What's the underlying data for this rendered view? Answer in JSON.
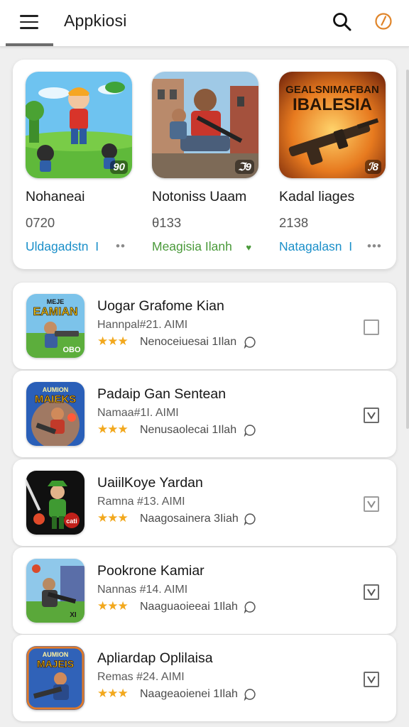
{
  "header": {
    "title": "Appkiosi"
  },
  "icons": {
    "menu": "hamburger-menu-icon",
    "search": "search-icon",
    "history": "clock-history-icon"
  },
  "colors": {
    "accent_blue": "#1a8fc9",
    "accent_green": "#4a9a3a",
    "star": "#f2a81d",
    "history_icon": "#e0852a"
  },
  "featured": [
    {
      "name": "Nohaneai",
      "count": "0720",
      "action": "Uldagadstn",
      "action_suffix": "I",
      "more": "••",
      "badge": "90",
      "action_color": "#1a8fc9"
    },
    {
      "name": "Notoniss Uaam",
      "count": "θ133",
      "action": "Meagisia Ilanh",
      "action_suffix": "♥",
      "more": "",
      "badge": "ℑ9",
      "action_color": "#4a9a3a"
    },
    {
      "name": "Kadal liages",
      "count": "2138",
      "action": "Natagalasn",
      "action_suffix": "I",
      "more": "•••",
      "badge": "ℐ8",
      "action_color": "#1a8fc9",
      "thumb_text_top": "GEALSNIMAFBAN",
      "thumb_text_bottom": "IBALESIA"
    }
  ],
  "list": [
    {
      "title": "Uogar Grafome Kian",
      "sub": "Hannpal#21. AIMI",
      "stars": "★★★",
      "meta": "Nenoceiuesai 1Ilan",
      "checked": false,
      "thumb_text": "EAMIAN",
      "thumb_top": "MEJE"
    },
    {
      "title": "Padaip Gan Sentean",
      "sub": "Namaa#1I. AIMI",
      "stars": "★★★",
      "meta": "Nenusaolecai 1Ilah",
      "checked": true,
      "thumb_text": "MAIEKS",
      "thumb_top": "AUMION"
    },
    {
      "title": "UaiilKoye Yardan",
      "sub": "Ramna #13. AIMI",
      "stars": "★★★",
      "meta": "Naagosainera 3Iiah",
      "checked": true,
      "thumb_text": "cati",
      "thumb_top": ""
    },
    {
      "title": "Pookrone Kamiar",
      "sub": "Nannas #14. AIMI",
      "stars": "★★★",
      "meta": "Naaguaoieeai 1Ilah",
      "checked": true,
      "thumb_text": "XI",
      "thumb_top": ""
    },
    {
      "title": "Apliardap Oplilaisa",
      "sub": "Remas #24. AIMI",
      "stars": "★★★",
      "meta": "Naageaoienei 1Ilah",
      "checked": true,
      "thumb_text": "MAJEIS",
      "thumb_top": "AUMION"
    }
  ]
}
